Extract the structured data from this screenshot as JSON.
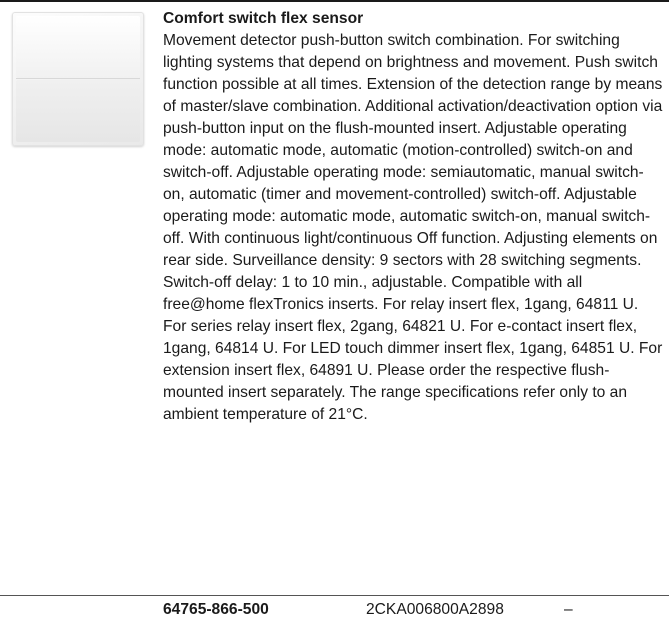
{
  "product": {
    "image_alt": "switch-flex-sensor-image",
    "title": "Comfort switch flex sensor",
    "description": "Movement detector push-button switch combination. For switching lighting systems that depend on brightness and movement. Push switch function possible at all times. Extension of the detection range by means of master/slave combination. Additional activation/deactivation option via push-button input on the flush-mounted insert. Adjustable operating mode: automatic mode, automatic (motion-controlled) switch-on and switch-off. Adjustable operating mode: semiautomatic, manual switch-on, automatic (timer and movement-controlled) switch-off. Adjustable operating mode: automatic mode, automatic switch-on, manual switch-off. With continuous light/continuous Off function. Adjusting elements on rear side. Surveillance density: 9 sectors with 28 switching segments. Switch-off delay: 1 to 10 min., adjustable. Compatible with all free@home flexTronics inserts. For relay insert flex, 1gang, 64811 U. For series relay insert flex, 2gang, 64821 U. For e-contact insert flex, 1gang, 64814 U. For LED touch dimmer insert flex, 1gang, 64851 U. For extension insert flex, 64891 U. Please order the respective flush-mounted insert separately. The range specifications refer only to an ambient temperature of 21°C."
  },
  "order_row": {
    "order_number": "64765-866-500",
    "ean_code": "2CKA006800A2898",
    "extra": "–"
  }
}
